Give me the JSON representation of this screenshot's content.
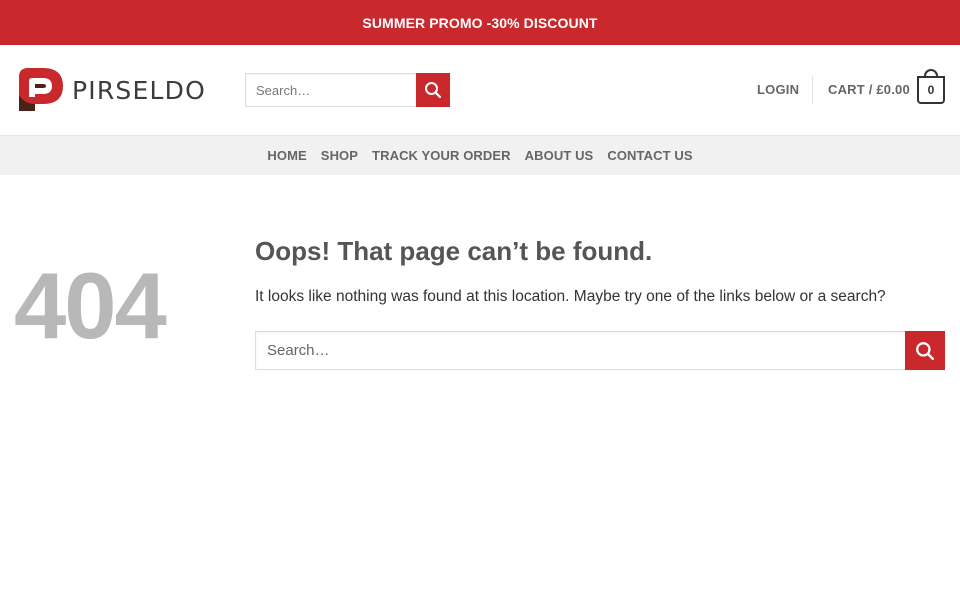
{
  "promo": {
    "text": "SUMMER PROMO -30% DISCOUNT"
  },
  "brand": {
    "name": "PIRSELDO",
    "accent": "#c9282d",
    "dark": "#4a2318"
  },
  "header": {
    "search_placeholder": "Search…",
    "login_label": "LOGIN",
    "cart_label": "CART / £0.00",
    "cart_count": "0"
  },
  "nav": {
    "items": [
      {
        "label": "HOME"
      },
      {
        "label": "SHOP"
      },
      {
        "label": "TRACK YOUR ORDER"
      },
      {
        "label": "ABOUT US"
      },
      {
        "label": "CONTACT US"
      }
    ]
  },
  "error": {
    "code": "404",
    "title": "Oops! That page can’t be found.",
    "message": "It looks like nothing was found at this location. Maybe try one of the links below or a search?",
    "search_placeholder": "Search…"
  },
  "icons": {
    "search": "search-icon",
    "cart": "shopping-bag-icon"
  }
}
